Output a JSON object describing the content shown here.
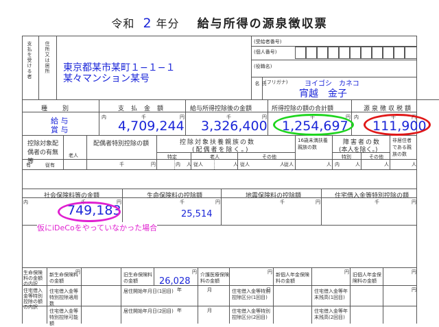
{
  "header": {
    "era": "令和",
    "year": "2",
    "suffix": "年分",
    "doc_title": "給与所得の源泉徴収票"
  },
  "payer_block": {
    "recipient_label": "支払を受ける者",
    "address_label": "住所又は居所",
    "address_line1": "東京都某市某町１−１−１",
    "address_line2": "某々マンション某号",
    "recipient_no_label": "(受給者番号)",
    "personal_no_label": "(個人番号)",
    "position_label": "(役職名)",
    "name_label": "氏名",
    "furigana_label": "(フリガナ)",
    "furigana": "ヨイゴシ　カネコ",
    "name": "宵越　金子"
  },
  "income_header": {
    "type": "種別",
    "payment": "支払金額",
    "after_deduction": "給与所得控除後の金額",
    "deduction_total": "所得控除の額の合計額",
    "withholding": "源泉徴収税額"
  },
  "income_row": {
    "type_line1": "給 与",
    "type_line2": "賞 与",
    "inner": "内",
    "unit_sen": "千",
    "unit_en": "円",
    "payment": "4,709,244",
    "after_deduction": "3,326,400",
    "deduction_total": "1,254,697",
    "withholding": "111,900"
  },
  "dependents": {
    "spouse_label": "控除対象配偶者の有無等",
    "elderly": "老人",
    "spouse_special": "配偶者特別控除の額",
    "dependents_label": "控除対象扶養親族の数",
    "dependents_sub": "(配偶者を除く。)",
    "specific": "特定",
    "old": "老人",
    "other": "その他",
    "under16": "16歳未満扶養親族の数",
    "disabled_label": "障害者の数",
    "disabled_sub": "(本人を除く。)",
    "special": "特別",
    "other2": "その他",
    "non_resident": "非居住者である親族の数",
    "yes": "有",
    "subordinate": "従有",
    "inner": "内",
    "person": "人",
    "from": "従人"
  },
  "deductions": {
    "social_label": "社会保険料等の金額",
    "life_label": "生命保険料の控除額",
    "quake_label": "地震保険料の控除額",
    "housing_label": "住宅借入金等特別控除の額",
    "social_amount": "749,183",
    "life_amount": "25,514",
    "note": "仮にiDeCoをやっていなかった場合"
  },
  "detail": {
    "breakdown_label": "生命保険料の金額の内訳",
    "new_life": "新生命保険料の金額",
    "old_life": "旧生命保険料の金額",
    "old_life_value": "26,028",
    "care": "介護医療保険料の金額",
    "new_pension": "新個人年金保険料の金額",
    "old_pension": "旧個人年金保険料の金額",
    "housing_breakdown": "住宅借入金等特別控除の額の内訳",
    "housing_count": "住宅借入金等特別控除適用数",
    "residence_date1": "居住開始年月日(1回目)",
    "residence_date2": "居住開始年月日(2回目)",
    "section1": "住宅借入金等特別控除区分(1回目)",
    "section2": "住宅借入金等特別控除区分(2回目)",
    "balance1": "住宅借入金等年末残高(1回目)",
    "balance2": "住宅借入金等年末残高(2回目)",
    "capacity": "住宅借入金等特別控除可能額",
    "year": "年",
    "month": "月",
    "day": "日"
  },
  "colors": {
    "blue_text": "#1a25d8",
    "green_circle": "#1ed51e",
    "red_circle": "#e01818",
    "pink_circle": "#e020d0"
  }
}
